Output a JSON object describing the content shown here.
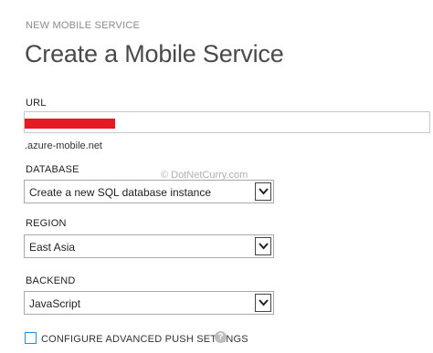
{
  "header": {
    "supertitle": "NEW MOBILE SERVICE",
    "title": "Create a Mobile Service"
  },
  "url": {
    "label": "URL",
    "value": "",
    "suffix": ".azure-mobile.net"
  },
  "watermark": "© DotNetCurry.com",
  "database": {
    "label": "DATABASE",
    "selected": "Create a new SQL database instance"
  },
  "region": {
    "label": "REGION",
    "selected": "East Asia"
  },
  "backend": {
    "label": "BACKEND",
    "selected": "JavaScript"
  },
  "push": {
    "label": "CONFIGURE ADVANCED PUSH SETTINGS",
    "help_glyph": "?"
  },
  "colors": {
    "redaction": "#e41b23",
    "checkbox_border": "#2a8dd4"
  }
}
